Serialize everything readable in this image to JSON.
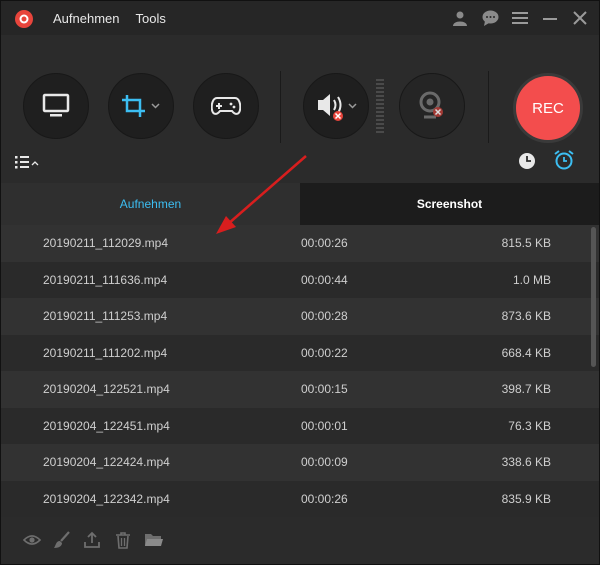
{
  "menu": {
    "item1": "Aufnehmen",
    "item2": "Tools"
  },
  "title_icons": [
    "user-icon",
    "chat-icon",
    "menu-icon",
    "minimize-icon",
    "close-icon"
  ],
  "controls": {
    "screen_icon": "monitor-icon",
    "region_icon": "crop-icon",
    "game_icon": "gamepad-icon",
    "audio_icon": "speaker-muted-icon",
    "webcam_icon": "webcam-off-icon",
    "rec_label": "REC",
    "accent": "#3cbef2",
    "rec_color": "#f34d4d"
  },
  "tabs": [
    {
      "label": "Aufnehmen",
      "active": true
    },
    {
      "label": "Screenshot",
      "active": false
    }
  ],
  "recordings": [
    {
      "name": "20190211_112029.mp4",
      "duration": "00:00:26",
      "size": "815.5 KB"
    },
    {
      "name": "20190211_111636.mp4",
      "duration": "00:00:44",
      "size": "1.0 MB"
    },
    {
      "name": "20190211_111253.mp4",
      "duration": "00:00:28",
      "size": "873.6 KB"
    },
    {
      "name": "20190211_111202.mp4",
      "duration": "00:00:22",
      "size": "668.4 KB"
    },
    {
      "name": "20190204_122521.mp4",
      "duration": "00:00:15",
      "size": "398.7 KB"
    },
    {
      "name": "20190204_122451.mp4",
      "duration": "00:00:01",
      "size": "76.3 KB"
    },
    {
      "name": "20190204_122424.mp4",
      "duration": "00:00:09",
      "size": "338.6 KB"
    },
    {
      "name": "20190204_122342.mp4",
      "duration": "00:00:26",
      "size": "835.9 KB"
    }
  ],
  "footer_icons": [
    "eye-icon",
    "brush-icon",
    "upload-icon",
    "trash-icon",
    "folder-icon"
  ]
}
